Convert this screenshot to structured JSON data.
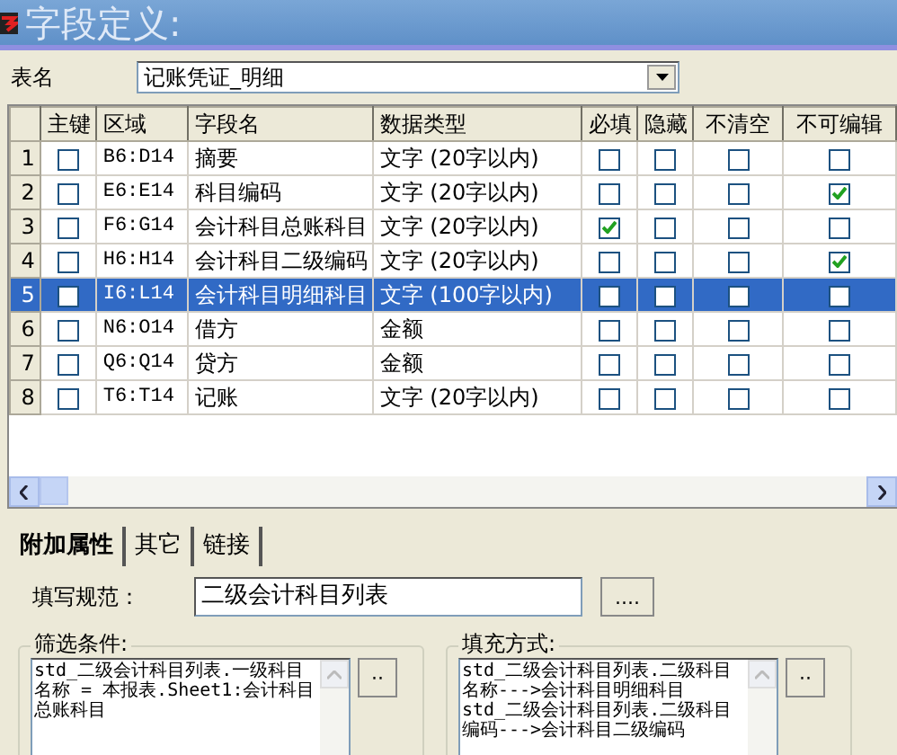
{
  "window": {
    "title": "字段定义:"
  },
  "table_name": {
    "label": "表名",
    "value": "记账凭证_明细"
  },
  "grid": {
    "columns": [
      "主键",
      "区域",
      "字段名",
      "数据类型",
      "必填",
      "隐藏",
      "不清空",
      "不可编辑"
    ],
    "rows": [
      {
        "number": "1",
        "primary_key": false,
        "range": "B6:D14",
        "field_name": "摘要",
        "data_type": "文字 (20字以内)",
        "required": false,
        "hidden": false,
        "keep_value": false,
        "read_only": false,
        "selected": false
      },
      {
        "number": "2",
        "primary_key": false,
        "range": "E6:E14",
        "field_name": "科目编码",
        "data_type": "文字 (20字以内)",
        "required": false,
        "hidden": false,
        "keep_value": false,
        "read_only": true,
        "selected": false
      },
      {
        "number": "3",
        "primary_key": false,
        "range": "F6:G14",
        "field_name": "会计科目总账科目",
        "data_type": "文字 (20字以内)",
        "required": true,
        "hidden": false,
        "keep_value": false,
        "read_only": false,
        "selected": false
      },
      {
        "number": "4",
        "primary_key": false,
        "range": "H6:H14",
        "field_name": "会计科目二级编码",
        "data_type": "文字 (20字以内)",
        "required": false,
        "hidden": false,
        "keep_value": false,
        "read_only": true,
        "selected": false
      },
      {
        "number": "5",
        "primary_key": false,
        "range": "I6:L14",
        "field_name": "会计科目明细科目",
        "data_type": "文字 (100字以内)",
        "required": false,
        "hidden": false,
        "keep_value": false,
        "read_only": false,
        "selected": true
      },
      {
        "number": "6",
        "primary_key": false,
        "range": "N6:O14",
        "field_name": "借方",
        "data_type": "金额",
        "required": false,
        "hidden": false,
        "keep_value": false,
        "read_only": false,
        "selected": false
      },
      {
        "number": "7",
        "primary_key": false,
        "range": "Q6:Q14",
        "field_name": "贷方",
        "data_type": "金额",
        "required": false,
        "hidden": false,
        "keep_value": false,
        "read_only": false,
        "selected": false
      },
      {
        "number": "8",
        "primary_key": false,
        "range": "T6:T14",
        "field_name": "记账",
        "data_type": "文字 (20字以内)",
        "required": false,
        "hidden": false,
        "keep_value": false,
        "read_only": false,
        "selected": false
      }
    ]
  },
  "tabs": [
    {
      "label": "附加属性",
      "selected": true
    },
    {
      "label": "其它",
      "selected": false
    },
    {
      "label": "链接",
      "selected": false
    }
  ],
  "fill_rule": {
    "label": "填写规范：",
    "value": "二级会计科目列表",
    "button": "...."
  },
  "filter": {
    "label": "筛选条件:",
    "value": "std_二级会计科目列表.一级科目名称 = 本报表.Sheet1:会计科目总账科目",
    "button": "··"
  },
  "fill_mode": {
    "label": "填充方式:",
    "value": "std_二级会计科目列表.二级科目名称--->会计科目明细科目\nstd_二级会计科目列表.二级科目编码--->会计科目二级编码",
    "button": "··"
  }
}
